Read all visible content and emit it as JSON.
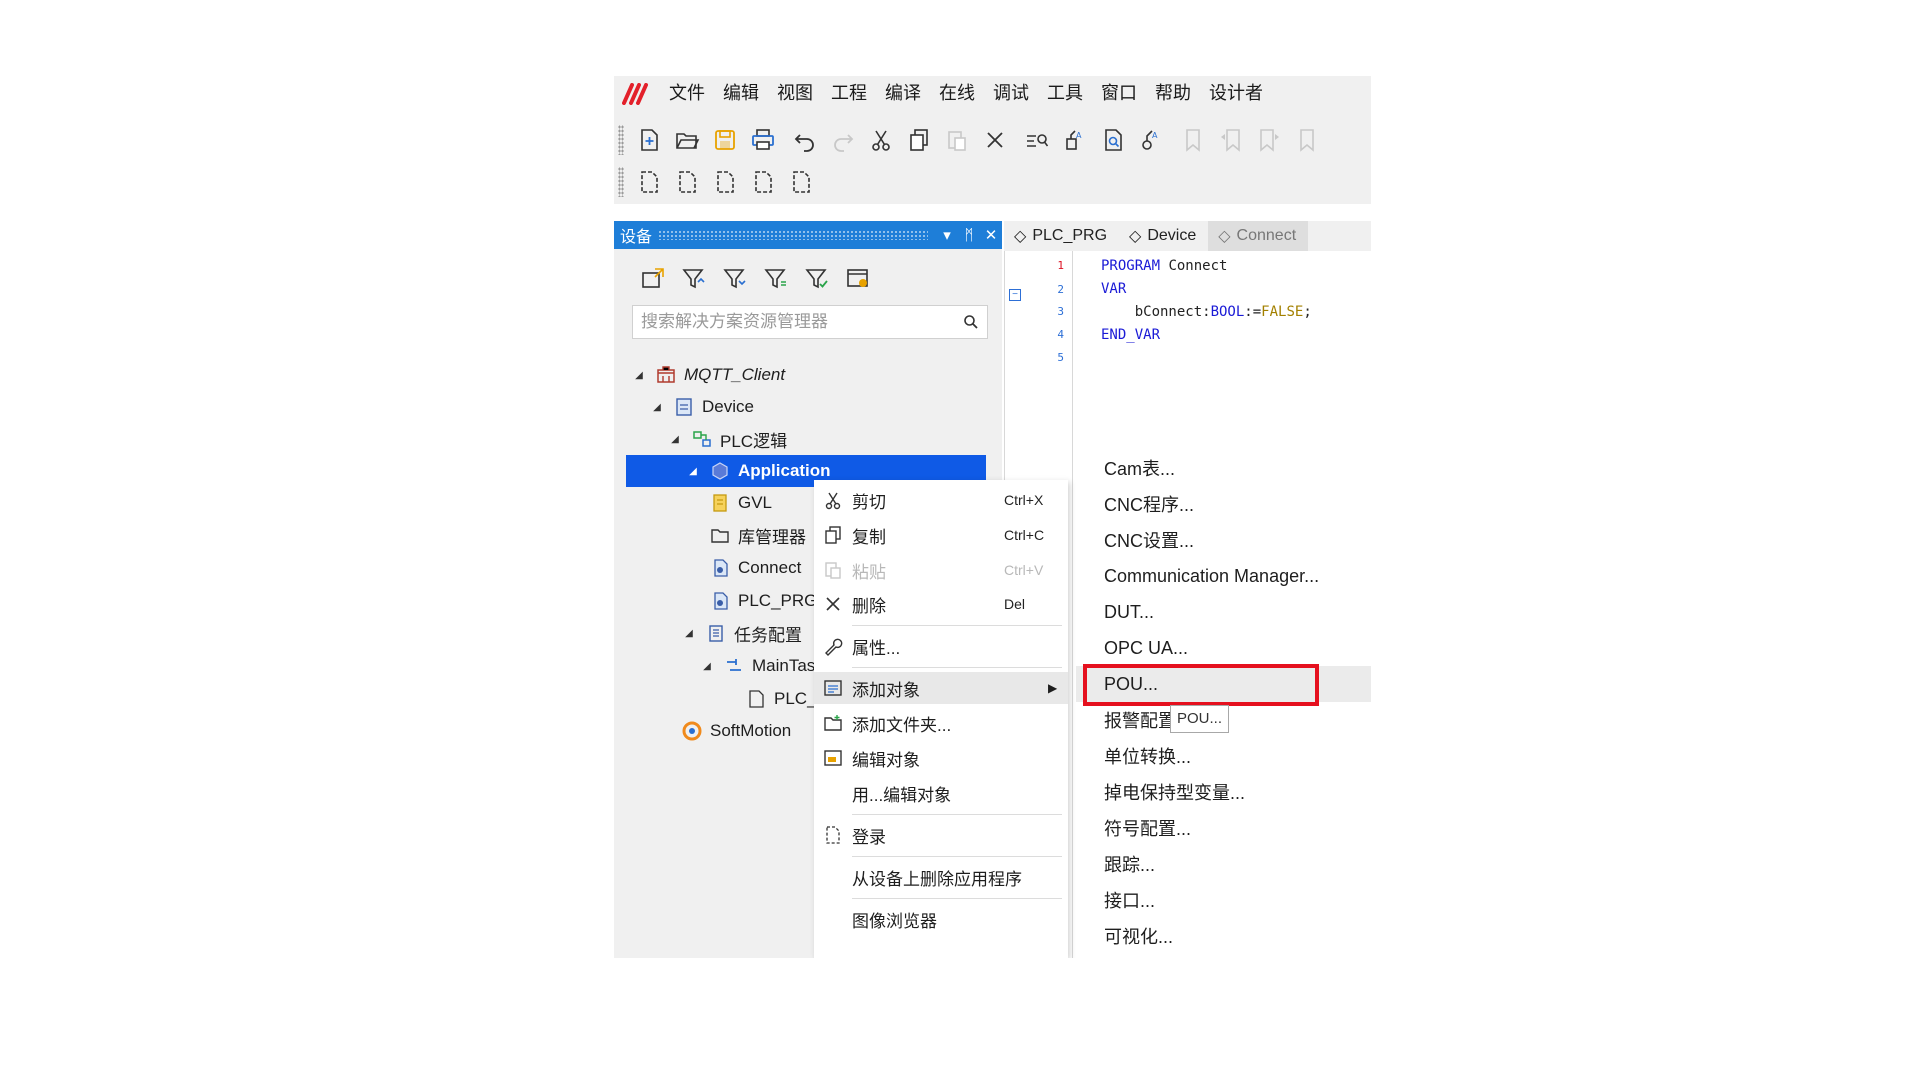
{
  "menu": {
    "logo": "logo-icon",
    "items": [
      "文件",
      "编辑",
      "视图",
      "工程",
      "编译",
      "在线",
      "调试",
      "工具",
      "窗口",
      "帮助",
      "设计者"
    ]
  },
  "toolbar": {
    "row1": [
      "new-project-icon",
      "open-project-icon",
      "save-project-icon",
      "print-icon",
      "undo-icon",
      "redo-icon",
      "cut-icon",
      "copy-icon",
      "paste-icon",
      "delete-icon",
      "find-icon",
      "replace-icon",
      "find-in-file-icon",
      "bookmark-icon",
      "bookmark-prev-icon",
      "bookmark-next-icon",
      "bookmark-clear-icon",
      "bookmark-list-icon"
    ],
    "row2": [
      "doc1-icon",
      "doc2-icon",
      "doc3-icon",
      "doc4-icon",
      "doc5-icon"
    ]
  },
  "panel": {
    "title": "设备",
    "pin": "ᛗ",
    "search_placeholder": "搜索解决方案资源管理器"
  },
  "tree": [
    {
      "label": "MQTT_Client",
      "icon": "project-icon"
    },
    {
      "label": "Device",
      "icon": "device-icon"
    },
    {
      "label": "PLC逻辑",
      "icon": "plc-logic-icon"
    },
    {
      "label": "Application",
      "icon": "application-icon"
    },
    {
      "label": "GVL",
      "icon": "gvl-icon"
    },
    {
      "label": "库管理器",
      "icon": "library-folder-icon"
    },
    {
      "label": "Connect",
      "icon": "pou-icon"
    },
    {
      "label": "PLC_PRG",
      "icon": "pou-icon"
    },
    {
      "label": "任务配置",
      "icon": "task-config-icon"
    },
    {
      "label": "MainTask",
      "icon": "task-icon"
    },
    {
      "label": "PLC_PRG",
      "icon": "program-call-icon"
    },
    {
      "label": "SoftMotion",
      "icon": "softmotion-icon"
    }
  ],
  "tabs": [
    "PLC_PRG",
    "Device",
    "Connect"
  ],
  "code": {
    "line_numbers": [
      "1",
      "2",
      "3",
      "4",
      "5"
    ],
    "l1_kw": "PROGRAM",
    "l1_name": " Connect",
    "l2_kw": "VAR",
    "l3_name": "    bConnect:",
    "l3_type": "BOOL",
    "l3_op": ":=",
    "l3_val": "FALSE",
    "l3_end": ";",
    "l4_kw": "END_VAR"
  },
  "context_menu": {
    "cut": {
      "label": "剪切",
      "shortcut": "Ctrl+X"
    },
    "copy": {
      "label": "复制",
      "shortcut": "Ctrl+C"
    },
    "paste": {
      "label": "粘贴",
      "shortcut": "Ctrl+V"
    },
    "delete": {
      "label": "删除",
      "shortcut": "Del"
    },
    "properties": "属性...",
    "add_object": "添加对象",
    "add_folder": "添加文件夹...",
    "edit_object": "编辑对象",
    "edit_with": "用...编辑对象",
    "login": "登录",
    "remove_app": "从设备上删除应用程序",
    "image_browser": "图像浏览器"
  },
  "submenu": [
    "Cam表...",
    "CNC程序...",
    "CNC设置...",
    "Communication Manager...",
    "DUT...",
    "OPC UA...",
    "POU...",
    "报警配置...",
    "单位转换...",
    "掉电保持型变量...",
    "符号配置...",
    "跟踪...",
    "接口...",
    "可视化..."
  ],
  "tooltip": "POU...",
  "colors": {
    "accent": "#1e7ed8",
    "selection": "#0f5ae6",
    "highlight_box": "#e5101e"
  }
}
